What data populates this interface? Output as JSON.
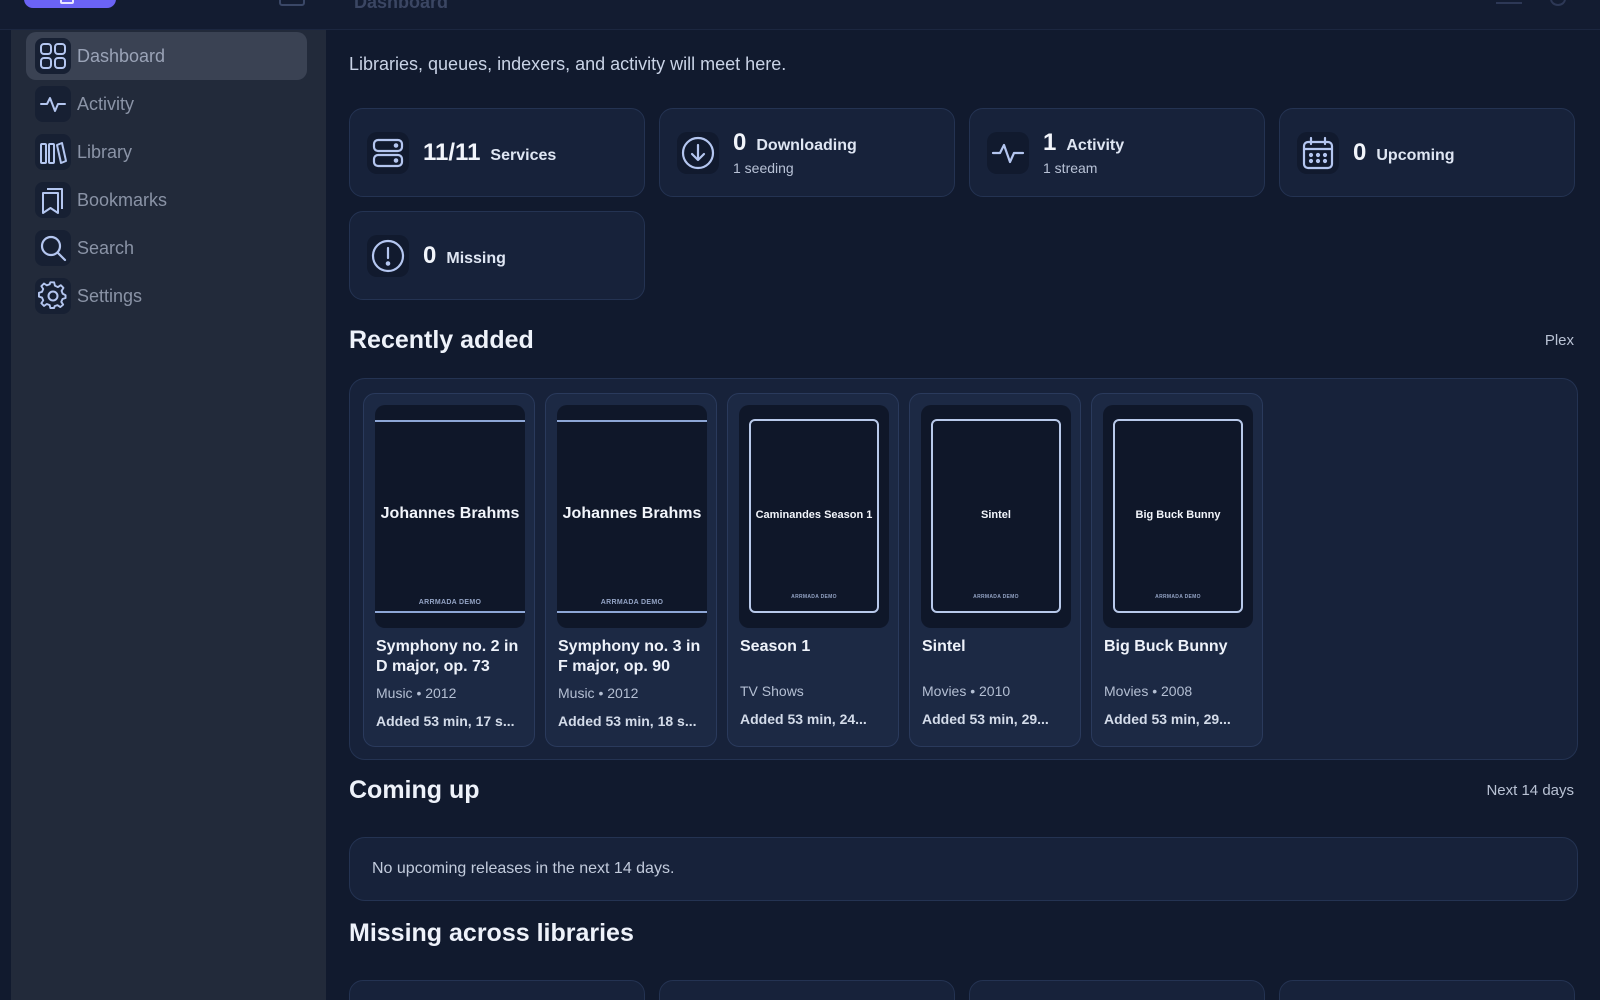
{
  "app": {
    "title": "Dashboard",
    "brand_color": "#6b63f5",
    "background": "#111a2e"
  },
  "sidebar": {
    "items": [
      {
        "label": "Dashboard",
        "icon": "grid-icon",
        "active": true
      },
      {
        "label": "Activity",
        "icon": "pulse-icon",
        "active": false
      },
      {
        "label": "Library",
        "icon": "library-icon",
        "active": false
      },
      {
        "label": "Bookmarks",
        "icon": "bookmarks-icon",
        "active": false
      },
      {
        "label": "Search",
        "icon": "search-icon",
        "active": false
      },
      {
        "label": "Settings",
        "icon": "gear-icon",
        "active": false
      }
    ]
  },
  "main": {
    "subtitle": "Libraries, queues, indexers, and activity will meet here.",
    "stats": [
      {
        "value": "11/11",
        "label": "Services",
        "sub": "",
        "icon": "server-icon"
      },
      {
        "value": "0",
        "label": "Downloading",
        "sub": "1 seeding",
        "icon": "download-icon"
      },
      {
        "value": "1",
        "label": "Activity",
        "sub": "1 stream",
        "icon": "pulse-icon"
      },
      {
        "value": "0",
        "label": "Upcoming",
        "sub": "",
        "icon": "calendar-icon"
      },
      {
        "value": "0",
        "label": "Missing",
        "sub": "",
        "icon": "alert-icon"
      }
    ],
    "recently_added": {
      "title": "Recently added",
      "source": "Plex",
      "items": [
        {
          "poster_title": "Johannes Brahms",
          "poster_brand": "ARRMADA DEMO",
          "title": "Symphony no. 2 in D major, op. 73",
          "meta": "Music • 2012",
          "added": "Added 53 min, 17 s..."
        },
        {
          "poster_title": "Johannes Brahms",
          "poster_brand": "ARRMADA DEMO",
          "title": "Symphony no. 3 in F major, op. 90",
          "meta": "Music • 2012",
          "added": "Added 53 min, 18 s..."
        },
        {
          "poster_title": "Caminandes Season 1",
          "poster_brand": "ARRMADA DEMO",
          "title": "Season 1",
          "meta": "TV Shows",
          "added": "Added 53 min, 24..."
        },
        {
          "poster_title": "Sintel",
          "poster_brand": "ARRMADA DEMO",
          "title": "Sintel",
          "meta": "Movies • 2010",
          "added": "Added 53 min, 29..."
        },
        {
          "poster_title": "Big Buck Bunny",
          "poster_brand": "ARRMADA DEMO",
          "title": "Big Buck Bunny",
          "meta": "Movies • 2008",
          "added": "Added 53 min, 29..."
        }
      ]
    },
    "coming_up": {
      "title": "Coming up",
      "range": "Next 14 days",
      "empty_text": "No upcoming releases in the next 14 days."
    },
    "missing": {
      "title": "Missing across libraries"
    }
  }
}
